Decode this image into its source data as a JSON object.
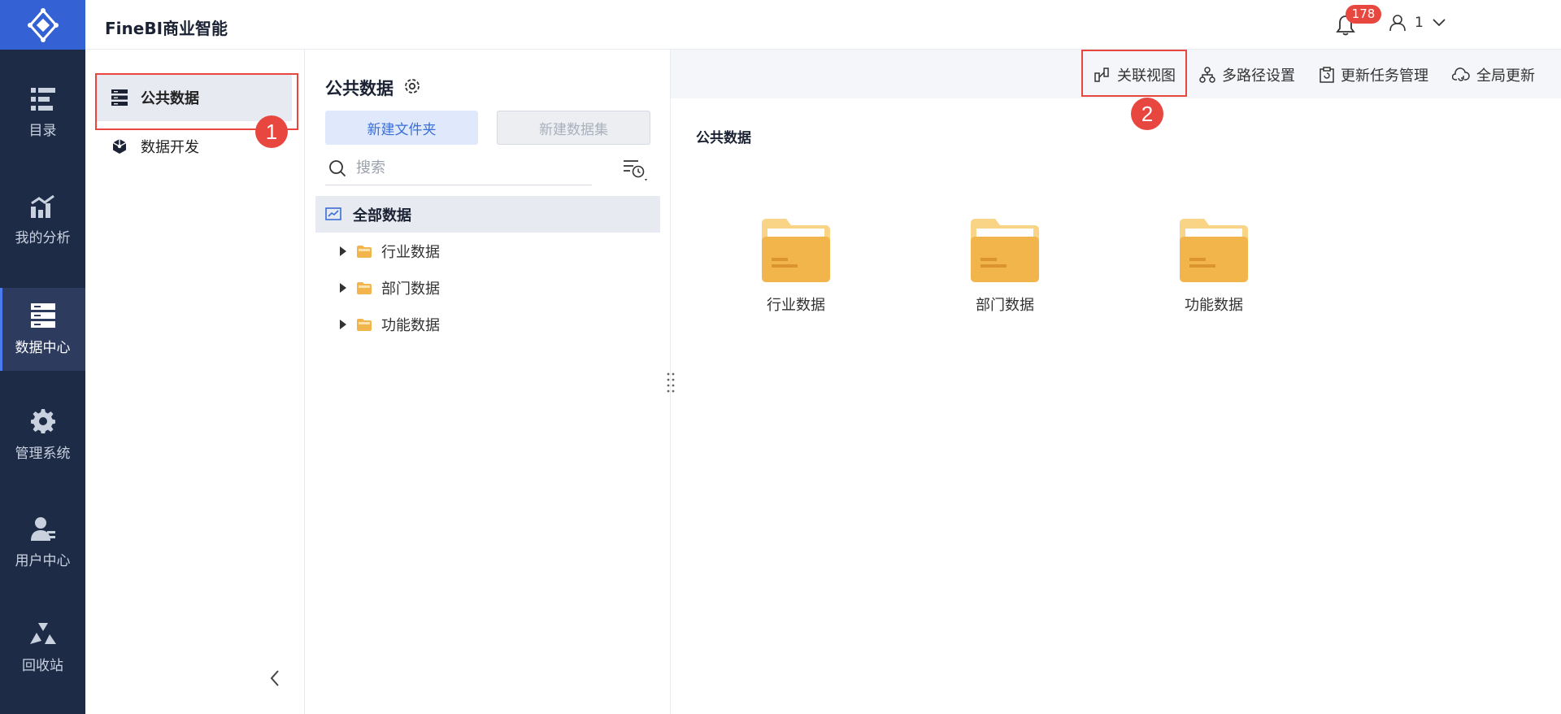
{
  "app": {
    "title": "FineBI商业智能"
  },
  "header": {
    "notification_count": "178",
    "user_name": "1"
  },
  "rail": {
    "items": [
      {
        "label": "目录",
        "icon": "catalog-icon"
      },
      {
        "label": "我的分析",
        "icon": "analysis-icon"
      },
      {
        "label": "数据中心",
        "icon": "data-center-icon",
        "active": true
      },
      {
        "label": "管理系统",
        "icon": "gear-icon"
      },
      {
        "label": "用户中心",
        "icon": "user-icon"
      },
      {
        "label": "回收站",
        "icon": "recycle-icon"
      }
    ]
  },
  "menu": {
    "items": [
      {
        "label": "公共数据",
        "icon": "public-data-icon",
        "active": true
      },
      {
        "label": "数据开发",
        "icon": "cube-icon"
      }
    ]
  },
  "tree": {
    "title": "公共数据",
    "new_folder_label": "新建文件夹",
    "new_dataset_label": "新建数据集",
    "search_placeholder": "搜索",
    "root_label": "全部数据",
    "nodes": [
      {
        "label": "行业数据"
      },
      {
        "label": "部门数据"
      },
      {
        "label": "功能数据"
      }
    ]
  },
  "toolbar": {
    "relation_view": "关联视图",
    "multipath": "多路径设置",
    "task_manage": "更新任务管理",
    "global_update": "全局更新"
  },
  "content": {
    "title": "公共数据",
    "folders": [
      {
        "label": "行业数据"
      },
      {
        "label": "部门数据"
      },
      {
        "label": "功能数据"
      }
    ]
  },
  "annotations": {
    "marker1": "1",
    "marker2": "2"
  },
  "colors": {
    "rail_bg": "#1e2b47",
    "brand": "#3462d4",
    "folder": "#f2b54c",
    "annotation": "#e8473f"
  }
}
